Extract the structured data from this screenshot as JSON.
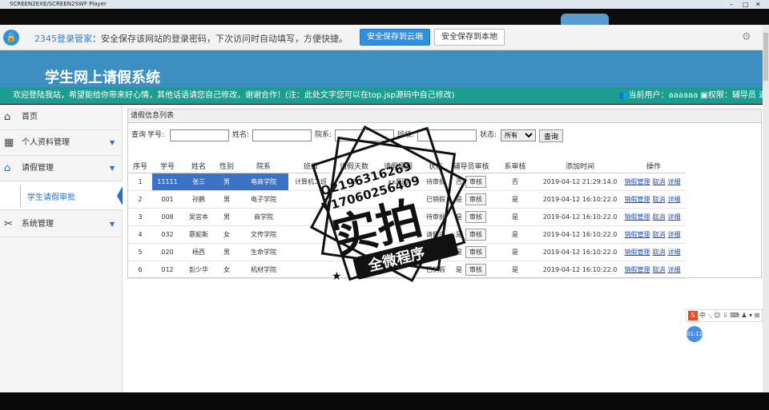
{
  "player": {
    "title": "SCREEN2EXE/SCREEN2SWF Player",
    "controls": [
      "–",
      "□",
      "✕"
    ]
  },
  "password_bar": {
    "brand": "2345登录管家",
    "message": "：安全保存该网站的登录密码，下次访问时自动填写，方便快捷。",
    "save_cloud": "安全保存到云端",
    "save_local": "安全保存到本地"
  },
  "header": {
    "title": "学生网上请假系统"
  },
  "welcome": {
    "text": "欢迎登陆我站，希望能给你带来好心情，其他话语请您自己修改，谢谢合作！(注：此处文字您可以在top.jsp源码中自己修改)",
    "user_label": "当前用户：",
    "user": "aaaaaa",
    "role_label": "权限：",
    "role": "辅导员",
    "logout": "退"
  },
  "sidebar": {
    "items": [
      {
        "label": "首页",
        "icon": "home-icon"
      },
      {
        "label": "个人资料管理",
        "icon": "grid-icon"
      },
      {
        "label": "请假管理",
        "icon": "home-icon"
      },
      {
        "label": "系统管理",
        "icon": "tools-icon"
      }
    ],
    "sub_item": "学生请假审批"
  },
  "panel": {
    "title": "请假信息列表"
  },
  "search": {
    "query_label": "查询",
    "student_no_label": "学号:",
    "name_label": "姓名:",
    "dept_label": "院系:",
    "class_label": "班级:",
    "status_label": "状态:",
    "status_value": "所有",
    "query_button": "查询"
  },
  "table": {
    "headers": [
      "序号",
      "学号",
      "姓名",
      "性别",
      "院系",
      "班级",
      "请假天数",
      "请假原因",
      "状态",
      "辅导员审核",
      "系审核",
      "添加时间",
      "操作"
    ],
    "rows": [
      {
        "seq": "1",
        "no": "11111",
        "name": "张三",
        "gender": "男",
        "dept": "电商学院",
        "cls": "计算机二班",
        "days": "2",
        "reason": "xx原因",
        "status": "待审批",
        "tutor": "否",
        "tutor_btn": "审核",
        "sys": "否",
        "time": "2019-04-12 21:29:14.0"
      },
      {
        "seq": "2",
        "no": "001",
        "name": "孙鹏",
        "gender": "男",
        "dept": "电子学院",
        "cls": "",
        "days": "",
        "reason": "",
        "status": "已销假",
        "tutor": "是",
        "tutor_btn": "审核",
        "sys": "是",
        "time": "2019-04-12 16:10:22.0"
      },
      {
        "seq": "3",
        "no": "008",
        "name": "吴官本",
        "gender": "男",
        "dept": "商学院",
        "cls": "",
        "days": "",
        "reason": "",
        "status": "待审批",
        "tutor": "是",
        "tutor_btn": "审核",
        "sys": "是",
        "time": "2019-04-12 16:10:22.0"
      },
      {
        "seq": "4",
        "no": "032",
        "name": "慕妮斯",
        "gender": "女",
        "dept": "文传学院",
        "cls": "",
        "days": "",
        "reason": "",
        "status": "请假中",
        "tutor": "是",
        "tutor_btn": "审核",
        "sys": "是",
        "time": "2019-04-12 16:10:22.0"
      },
      {
        "seq": "5",
        "no": "020",
        "name": "杨西",
        "gender": "男",
        "dept": "生命学院",
        "cls": "",
        "days": "",
        "reason": "",
        "status": "待审批",
        "tutor": "是",
        "tutor_btn": "审核",
        "sys": "是",
        "time": "2019-04-12 16:10:22.0"
      },
      {
        "seq": "6",
        "no": "012",
        "name": "彭少华",
        "gender": "女",
        "dept": "机材学院",
        "cls": "",
        "days": "",
        "reason": "",
        "status": "已销假",
        "tutor": "是",
        "tutor_btn": "审核",
        "sys": "是",
        "time": "2019-04-12 16:10:22.0"
      }
    ],
    "ops": [
      "销假管理",
      "取消",
      "详细"
    ]
  },
  "watermark": {
    "line1": "Q2196316269",
    "line2": "V17060256409",
    "big": "实拍",
    "sub": "全微程序"
  },
  "ime": {
    "logo": "S",
    "text": "中 ·, ☺ ⇩ ⌨ ♟ ▾ ⊞"
  },
  "clock": "01:12",
  "colors": {
    "header": "#3d8fc2",
    "welcome_bar": "#1b9d8f",
    "link": "#1a4ebd",
    "accent": "#2f8fe0"
  }
}
